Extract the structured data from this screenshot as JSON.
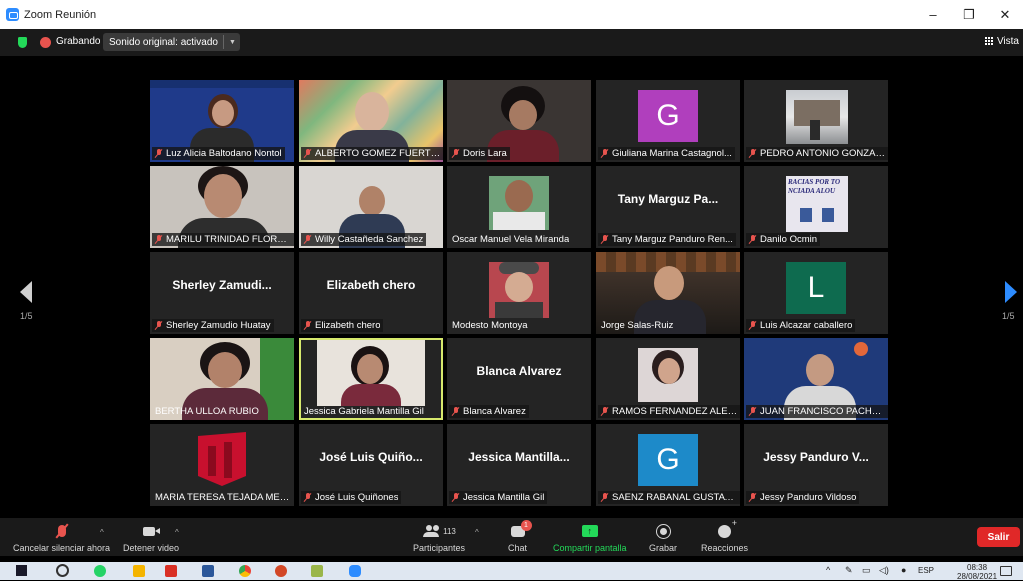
{
  "window": {
    "title": "Zoom Reunión",
    "minimize": "–",
    "restore": "❐",
    "close": "✕"
  },
  "topbar": {
    "recording_label": "Grabando",
    "audio_label": "Sonido original: activado",
    "view_label": "Vista"
  },
  "pager": {
    "left": "1/5",
    "right": "1/5"
  },
  "tiles": [
    {
      "name": "Luz Alicia Baltodano Nontol",
      "muted": true
    },
    {
      "name": "ALBERTO GOMEZ FUERTES",
      "muted": true
    },
    {
      "name": "Doris Lara",
      "muted": true
    },
    {
      "name": "Giuliana Marina Castagnol...",
      "muted": true,
      "avatar_letter": "G"
    },
    {
      "name": "PEDRO ANTONIO GONZAL...",
      "muted": true
    },
    {
      "name": "MARILU TRINIDAD FLORES...",
      "muted": true
    },
    {
      "name": "Willy Castañeda Sanchez",
      "muted": true
    },
    {
      "name": "Oscar Manuel Vela Miranda",
      "muted": false
    },
    {
      "name": "Tany Marguz Panduro Ren...",
      "muted": true,
      "display_text": "Tany Marguz Pa..."
    },
    {
      "name": "Danilo Ocmin",
      "muted": true,
      "banner_text": "RACIAS POR TO NCIADA ALOU"
    },
    {
      "name": "Sherley Zamudio Huatay",
      "muted": true,
      "display_text": "Sherley Zamudi..."
    },
    {
      "name": "Elizabeth chero",
      "muted": true,
      "display_text": "Elizabeth chero"
    },
    {
      "name": "Modesto Montoya",
      "muted": false
    },
    {
      "name": "Jorge Salas-Ruiz",
      "muted": false
    },
    {
      "name": "Luis Alcazar caballero",
      "muted": true,
      "avatar_letter": "L"
    },
    {
      "name": "BERTHA ULLOA RUBIO",
      "muted": false
    },
    {
      "name": "Jessica Gabriela Mantilla Gil",
      "muted": false
    },
    {
      "name": "Blanca Alvarez",
      "muted": true,
      "display_text": "Blanca Alvarez"
    },
    {
      "name": "RAMOS FERNANDEZ ALEJ...",
      "muted": true
    },
    {
      "name": "JUAN FRANCISCO PACHEC...",
      "muted": true
    },
    {
      "name": "MARIA TERESA TEJADA MEJIA",
      "muted": false
    },
    {
      "name": "José Luis Quiñones",
      "muted": true,
      "display_text": "José Luis Quiño..."
    },
    {
      "name": "Jessica Mantilla Gil",
      "muted": true,
      "display_text": "Jessica Mantilla..."
    },
    {
      "name": "SAENZ RABANAL GUSTAVO...",
      "muted": true,
      "avatar_letter": "G"
    },
    {
      "name": "Jessy Panduro Vildoso",
      "muted": true,
      "display_text": "Jessy Panduro V..."
    }
  ],
  "controls": {
    "mute": "Cancelar silenciar ahora",
    "video": "Detener video",
    "participants": "Participantes",
    "participants_count": "113",
    "chat": "Chat",
    "chat_badge": "1",
    "share": "Compartir pantalla",
    "record": "Grabar",
    "reactions": "Reacciones",
    "leave": "Salir"
  },
  "taskbar": {
    "language": "ESP",
    "time": "08:38",
    "date": "28/08/2021"
  },
  "colors": {
    "accent": "#2d8cff",
    "active_speaker": "#d7e96d",
    "leave": "#e02828",
    "share": "#23d959",
    "muted": "#e8544e"
  }
}
